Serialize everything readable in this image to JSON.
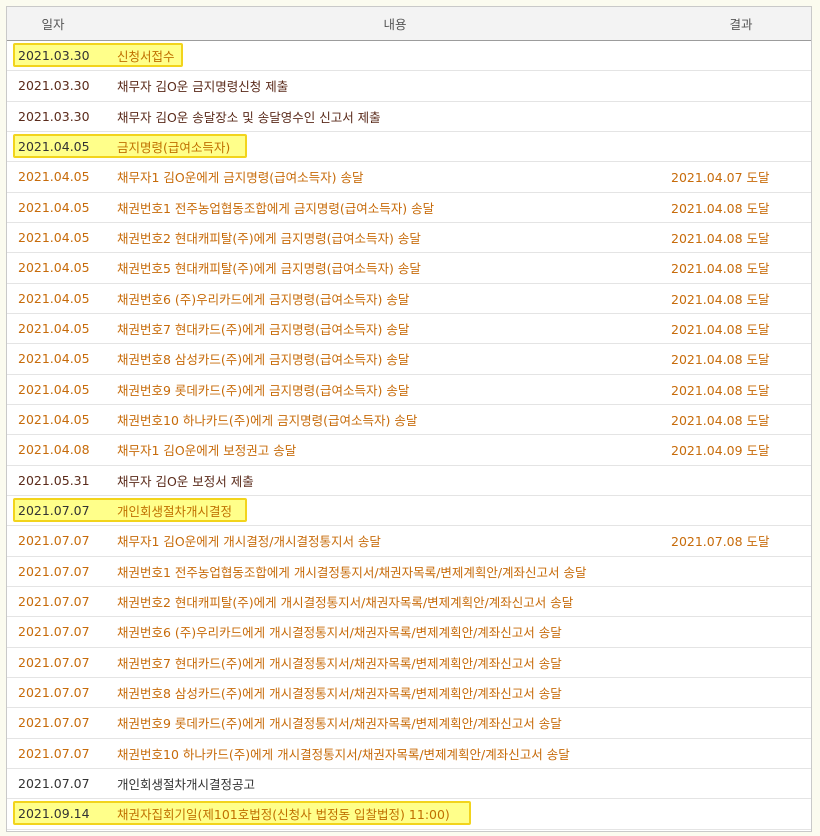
{
  "header": {
    "date": "일자",
    "content": "내용",
    "result": "결과"
  },
  "rows": [
    {
      "date": "2021.03.30",
      "content": "신청서접수",
      "result": "",
      "type": "stage"
    },
    {
      "date": "2021.03.30",
      "content": "채무자 김O운 금지명령신청 제출",
      "result": "",
      "type": "dark"
    },
    {
      "date": "2021.03.30",
      "content": "채무자 김O운 송달장소 및 송달영수인 신고서 제출",
      "result": "",
      "type": "dark"
    },
    {
      "date": "2021.04.05",
      "content": "금지명령(급여소득자)",
      "result": "",
      "type": "stage"
    },
    {
      "date": "2021.04.05",
      "content": "채무자1 김O운에게 금지명령(급여소득자) 송달",
      "result": "2021.04.07 도달",
      "type": "orange"
    },
    {
      "date": "2021.04.05",
      "content": "채권번호1 전주농업협동조합에게 금지명령(급여소득자) 송달",
      "result": "2021.04.08 도달",
      "type": "orange"
    },
    {
      "date": "2021.04.05",
      "content": "채권번호2 현대캐피탈(주)에게 금지명령(급여소득자) 송달",
      "result": "2021.04.08 도달",
      "type": "orange"
    },
    {
      "date": "2021.04.05",
      "content": "채권번호5 현대캐피탈(주)에게 금지명령(급여소득자) 송달",
      "result": "2021.04.08 도달",
      "type": "orange"
    },
    {
      "date": "2021.04.05",
      "content": "채권번호6 (주)우리카드에게 금지명령(급여소득자) 송달",
      "result": "2021.04.08 도달",
      "type": "orange"
    },
    {
      "date": "2021.04.05",
      "content": "채권번호7 현대카드(주)에게 금지명령(급여소득자) 송달",
      "result": "2021.04.08 도달",
      "type": "orange"
    },
    {
      "date": "2021.04.05",
      "content": "채권번호8 삼성카드(주)에게 금지명령(급여소득자) 송달",
      "result": "2021.04.08 도달",
      "type": "orange"
    },
    {
      "date": "2021.04.05",
      "content": "채권번호9 롯데카드(주)에게 금지명령(급여소득자) 송달",
      "result": "2021.04.08 도달",
      "type": "orange"
    },
    {
      "date": "2021.04.05",
      "content": "채권번호10 하나카드(주)에게 금지명령(급여소득자) 송달",
      "result": "2021.04.08 도달",
      "type": "orange"
    },
    {
      "date": "2021.04.08",
      "content": "채무자1 김O운에게 보정권고 송달",
      "result": "2021.04.09 도달",
      "type": "orange"
    },
    {
      "date": "2021.05.31",
      "content": "채무자 김O운 보정서 제출",
      "result": "",
      "type": "dark"
    },
    {
      "date": "2021.07.07",
      "content": "개인회생절차개시결정",
      "result": "",
      "type": "stage"
    },
    {
      "date": "2021.07.07",
      "content": "채무자1 김O운에게 개시결정/개시결정통지서 송달",
      "result": "2021.07.08 도달",
      "type": "orange"
    },
    {
      "date": "2021.07.07",
      "content": "채권번호1 전주농업협동조합에게 개시결정통지서/채권자목록/변제계획안/계좌신고서 송달",
      "result": "",
      "type": "orange"
    },
    {
      "date": "2021.07.07",
      "content": "채권번호2 현대캐피탈(주)에게 개시결정통지서/채권자목록/변제계획안/계좌신고서 송달",
      "result": "",
      "type": "orange"
    },
    {
      "date": "2021.07.07",
      "content": "채권번호6 (주)우리카드에게 개시결정통지서/채권자목록/변제계획안/계좌신고서 송달",
      "result": "",
      "type": "orange"
    },
    {
      "date": "2021.07.07",
      "content": "채권번호7 현대카드(주)에게 개시결정통지서/채권자목록/변제계획안/계좌신고서 송달",
      "result": "",
      "type": "orange"
    },
    {
      "date": "2021.07.07",
      "content": "채권번호8 삼성카드(주)에게 개시결정통지서/채권자목록/변제계획안/계좌신고서 송달",
      "result": "",
      "type": "orange"
    },
    {
      "date": "2021.07.07",
      "content": "채권번호9 롯데카드(주)에게 개시결정통지서/채권자목록/변제계획안/계좌신고서 송달",
      "result": "",
      "type": "orange"
    },
    {
      "date": "2021.07.07",
      "content": "채권번호10 하나카드(주)에게 개시결정통지서/채권자목록/변제계획안/계좌신고서 송달",
      "result": "",
      "type": "orange"
    },
    {
      "date": "2021.07.07",
      "content": "개인회생절차개시결정공고",
      "result": "",
      "type": "black"
    },
    {
      "date": "2021.09.14",
      "content": "채권자집회기일(제101호법정(신청사 법정동 입찰법정) 11:00)",
      "result": "",
      "type": "stage"
    }
  ],
  "highlight_widths": [
    170,
    234,
    234,
    458
  ]
}
